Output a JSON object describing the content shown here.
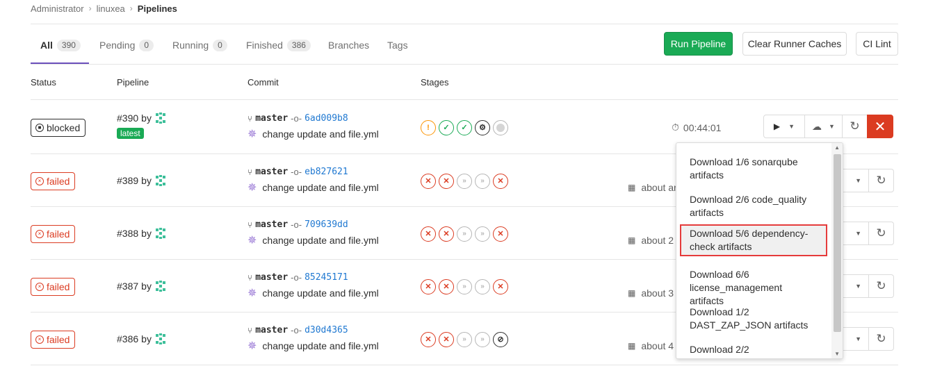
{
  "breadcrumb": {
    "items": [
      "Administrator",
      "linuxea",
      "Pipelines"
    ]
  },
  "tabs": [
    {
      "label": "All",
      "count": "390"
    },
    {
      "label": "Pending",
      "count": "0"
    },
    {
      "label": "Running",
      "count": "0"
    },
    {
      "label": "Finished",
      "count": "386"
    },
    {
      "label": "Branches"
    },
    {
      "label": "Tags"
    }
  ],
  "header_buttons": {
    "run_pipeline": "Run Pipeline",
    "clear_caches": "Clear Runner Caches",
    "ci_lint": "CI Lint"
  },
  "columns": {
    "status": "Status",
    "pipeline": "Pipeline",
    "commit": "Commit",
    "stages": "Stages"
  },
  "rows": [
    {
      "status": "blocked",
      "id": "#390",
      "by": "by",
      "badge": "latest",
      "branch": "master",
      "sha": "6ad009b8",
      "message": "change update and file.yml",
      "time": "00:44:01"
    },
    {
      "status": "failed",
      "id": "#389",
      "by": "by",
      "branch": "master",
      "sha": "eb827621",
      "message": "change update and file.yml",
      "ago": "about ar"
    },
    {
      "status": "failed",
      "id": "#388",
      "by": "by",
      "branch": "master",
      "sha": "709639dd",
      "message": "change update and file.yml",
      "ago": "about 2"
    },
    {
      "status": "failed",
      "id": "#387",
      "by": "by",
      "branch": "master",
      "sha": "85245171",
      "message": "change update and file.yml",
      "ago": "about 3"
    },
    {
      "status": "failed",
      "id": "#386",
      "by": "by",
      "branch": "master",
      "sha": "d30d4365",
      "message": "change update and file.yml",
      "ago": "about 4"
    }
  ],
  "artifacts_dropdown": {
    "items": [
      {
        "line1": "Download 1/6 sonarqube",
        "line2": "artifacts"
      },
      {
        "line1": "Download 2/6 code_quality",
        "line2": "artifacts"
      },
      {
        "line1": "Download 5/6 dependency-",
        "line2": "check artifacts"
      },
      {
        "line1": "Download 6/6",
        "line2": "license_management artifacts"
      },
      {
        "line1": "Download 1/2",
        "line2": "DAST_ZAP_JSON artifacts"
      },
      {
        "line1": "Download 2/2",
        "line2": ""
      }
    ],
    "selected_index": 2
  },
  "colors": {
    "accent": "#6b4fbb",
    "success": "#1aaa55",
    "danger": "#db3b21",
    "warning": "#fc9403",
    "link": "#1f78d1",
    "highlight": "#e53b3b"
  }
}
